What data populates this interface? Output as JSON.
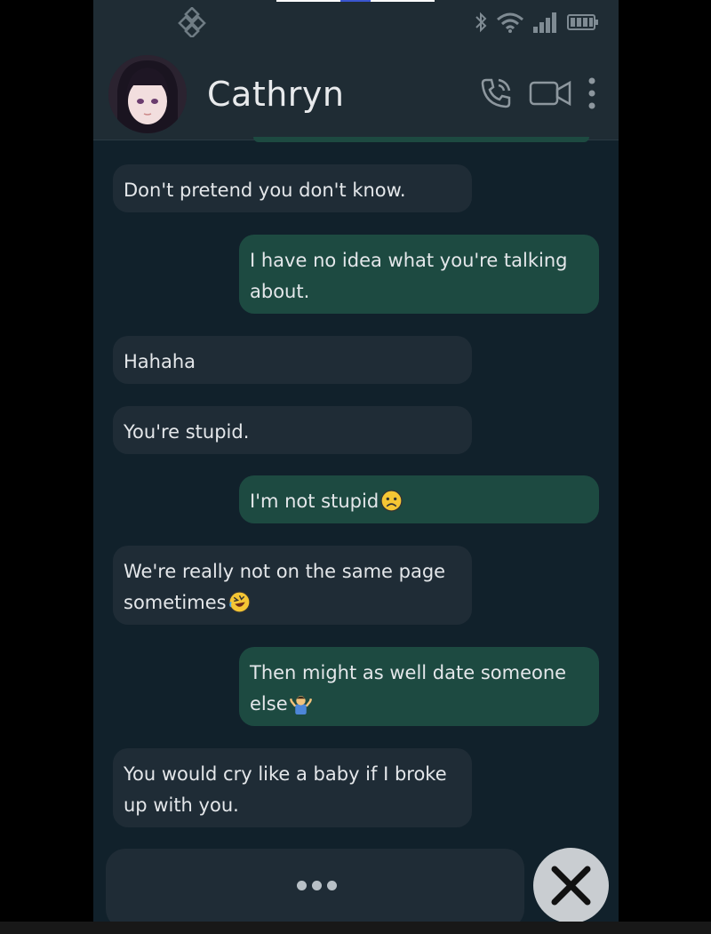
{
  "contact": {
    "name": "Cathryn"
  },
  "status_bar": {
    "icons": [
      "app-icon",
      "bluetooth-icon",
      "wifi-icon",
      "signal-icon",
      "battery-icon"
    ]
  },
  "header": {
    "icons": [
      "phone-call-icon",
      "video-call-icon",
      "more-vertical-icon"
    ]
  },
  "messages": [
    {
      "from": "contact",
      "text": "Don't pretend you don't know."
    },
    {
      "from": "me",
      "text": "I have no idea what you're talking about."
    },
    {
      "from": "contact",
      "text": "Hahaha"
    },
    {
      "from": "contact",
      "text": "You're stupid."
    },
    {
      "from": "me",
      "text": "I'm not stupid",
      "emoji": "frowning-face"
    },
    {
      "from": "contact",
      "text": "We're really not on the same page sometimes",
      "emoji": "rolling-on-floor-laughing"
    },
    {
      "from": "me",
      "text": "Then might as well date someone else",
      "emoji": "person-shrugging"
    },
    {
      "from": "contact",
      "text": "You would cry like a baby if I broke up with you."
    }
  ],
  "composer": {
    "indicator": "typing-dots",
    "close_icon": "close-icon"
  },
  "colors": {
    "background": "#11212b",
    "header": "#1f2c34",
    "received_bubble": "#1f2c36",
    "sent_bubble": "#1d4a41",
    "text": "#e4e7ea"
  }
}
